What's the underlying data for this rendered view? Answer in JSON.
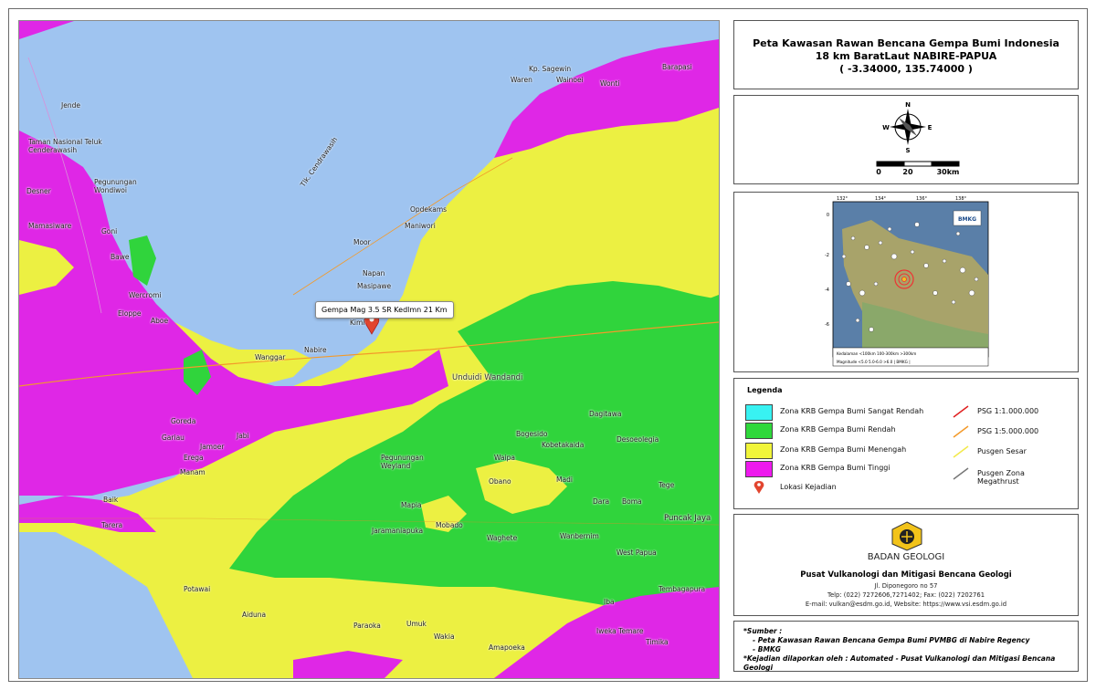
{
  "title": {
    "line1": "Peta Kawasan Rawan Bencana Gempa Bumi Indonesia",
    "line2": "18 km BaratLaut NABIRE-PAPUA",
    "line3": "( -3.34000, 135.74000 )"
  },
  "compass": {
    "n": "N",
    "s": "S",
    "e": "E",
    "w": "W"
  },
  "scalebar": {
    "ticks": [
      "0",
      "20",
      "30km"
    ]
  },
  "inset": {
    "lon_ticks": [
      "132°",
      "134°",
      "136°",
      "138°"
    ],
    "lat_ticks": [
      "0",
      "-2",
      "-4",
      "-6"
    ],
    "logo": "BMKG",
    "legend_row1": "Kedalaman  <100km  100-300km  >300km",
    "legend_row2": "Magnitude  <5.0  5.0-6.0  >6.0  | BMKG |"
  },
  "legend": {
    "title": "Legenda",
    "items": [
      {
        "label": "Zona KRB Gempa Bumi Sangat Rendah",
        "color": "#38f2f2"
      },
      {
        "label": "Zona KRB Gempa Bumi Rendah",
        "color": "#2fd83b"
      },
      {
        "label": "Zona KRB Gempa Bumi Menengah",
        "color": "#f1f53a"
      },
      {
        "label": "Zona KRB Gempa Bumi Tinggi",
        "color": "#ee1aee"
      },
      {
        "label": "Lokasi Kejadian",
        "color": "#e0402a"
      }
    ],
    "lines": [
      {
        "label": "PSG 1:1.000.000",
        "color": "#e02020"
      },
      {
        "label": "PSG 1:5.000.000",
        "color": "#f39a2a"
      },
      {
        "label": "Pusgen Sesar",
        "color": "#f3e94a"
      },
      {
        "label": "Pusgen Zona Megathrust",
        "color": "#777777"
      }
    ]
  },
  "logo": {
    "name": "BADAN GEOLOGI",
    "org": "Pusat Vulkanologi dan Mitigasi Bencana Geologi",
    "address": "Jl. Diponegoro no 57",
    "phone": "Telp: (022) 7272606,7271402; Fax: (022) 7202761",
    "contact": "E-mail: vulkan@esdm.go.id, Website: https://www.vsi.esdm.go.id"
  },
  "source": {
    "heading": "*Sumber :",
    "item1": "- Peta Kawasan Rawan Bencana Gempa Bumi PVMBG di Nabire Regency",
    "item2": "- BMKG",
    "reported": "*Kejadian dilaporkan oleh : Automated - Pusat Vulkanologi dan Mitigasi Bencana Geologi"
  },
  "map": {
    "callout": "Gempa Mag 3.5 SR Kedlmn 21 Km",
    "labels": [
      "Kp. Sagewin",
      "Barapasi",
      "Waren",
      "Wainoei",
      "Wonti",
      "Jende",
      "Taman Nasional Teluk Cenderawasih",
      "Desner",
      "Pegunungan Wondiwoi",
      "Tlk. Cendrawasih",
      "Opdekams",
      "Maniwori",
      "Moor",
      "Napan",
      "Masipawe",
      "Mamasiware",
      "Goni",
      "Bawe",
      "Wercromi",
      "Eloppe",
      "Aboe",
      "Kimi",
      "Nabire",
      "Wanggar",
      "Unduidi Wandandi",
      "Dagitawa",
      "Goreda",
      "Gariau",
      "Jamoer",
      "Jabi",
      "Erega",
      "Manam",
      "Mapia",
      "Bogesido",
      "Kobetakaida",
      "Waipa",
      "Obano",
      "Madi",
      "Desoeolegia",
      "Tege",
      "Dara",
      "Boma",
      "Puncak Jaya",
      "Baik",
      "Tarera",
      "Jaramaniapuka",
      "Mobado",
      "Waghete",
      "Wanbernim",
      "West Papua",
      "Potawai",
      "Tembagapura",
      "Iba",
      "Aiduna",
      "Paraoka",
      "Umuk",
      "Wakia",
      "Iweka Temare",
      "Amapoeka",
      "Timika",
      "Pegunungan Weyland"
    ]
  }
}
